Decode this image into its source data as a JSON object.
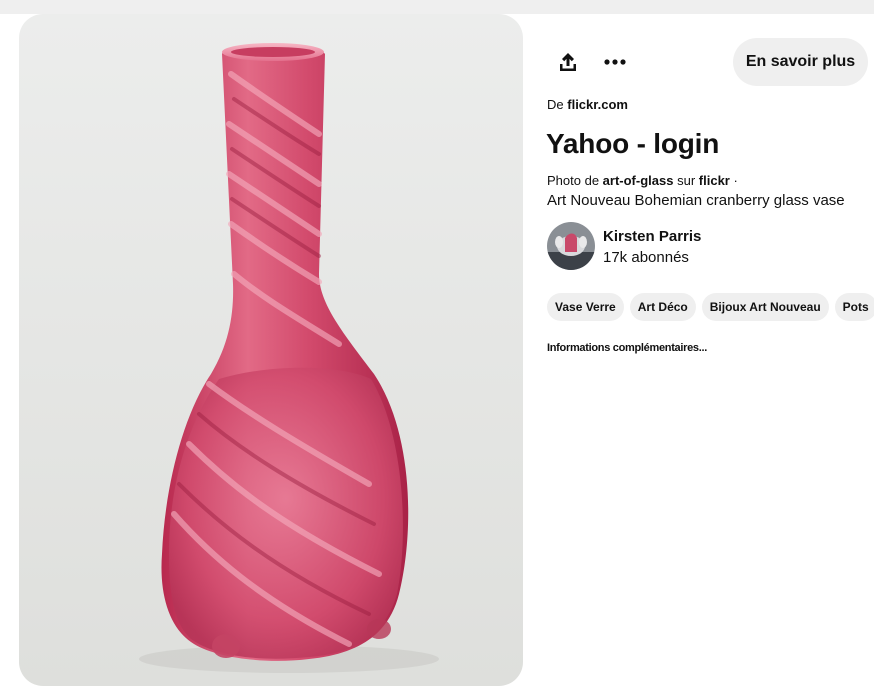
{
  "pin": {
    "image_alt": "Pink cranberry glass vase with swirled neck",
    "source_prefix": "De",
    "source_domain": "flickr.com",
    "title": "Yahoo - login",
    "photo_prefix": "Photo de",
    "photo_user": "art-of-glass",
    "photo_on": "sur",
    "photo_site": "flickr",
    "photo_sep": "·",
    "description": "Art Nouveau Bohemian cranberry glass vase"
  },
  "actions": {
    "share_icon": "share-icon",
    "more_icon": "ellipsis-icon",
    "learn_more": "En savoir plus"
  },
  "author": {
    "name": "Kirsten Parris",
    "followers": "17k abonnés"
  },
  "tags": [
    "Vase Verre",
    "Art Déco",
    "Bijoux Art Nouveau",
    "Pots"
  ],
  "more_info": "Informations complémentaires...",
  "colors": {
    "chip_bg": "#efefef",
    "glass": "#d44a6a",
    "background": "#e6e6e3"
  }
}
